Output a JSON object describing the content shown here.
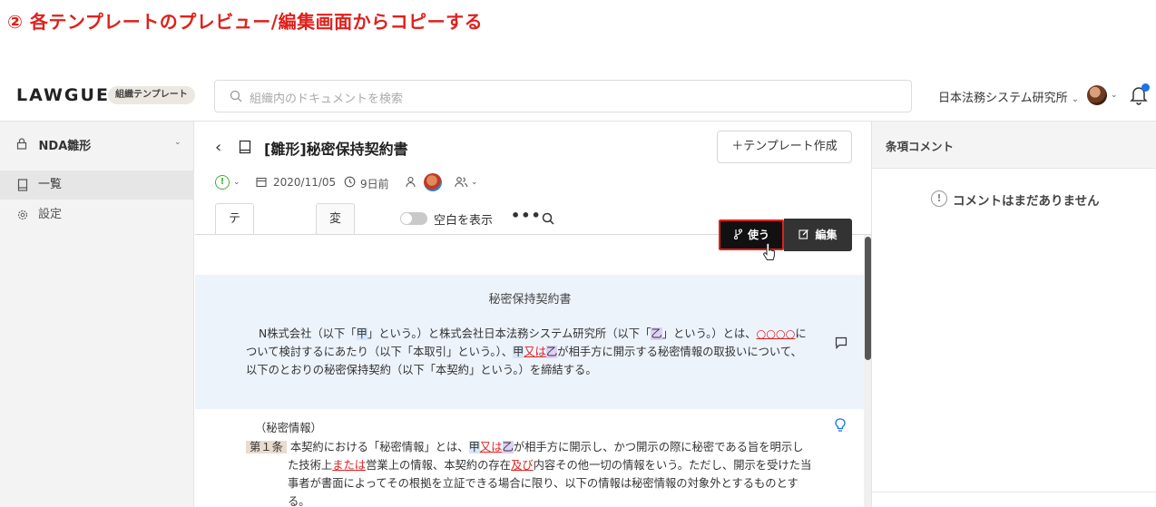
{
  "caption": "② 各テンプレートのプレビュー/編集画面からコピーする",
  "topbar": {
    "logo": "LAWGUE",
    "badge": "組織テンプレート",
    "search_placeholder": "組織内のドキュメントを検索",
    "org_name": "日本法務システム研究所",
    "org_chevron": "⌄"
  },
  "sidebar": {
    "project": "NDA雛形",
    "chevron": "⌄",
    "items": [
      {
        "label": "一覧",
        "icon": "document-icon"
      },
      {
        "label": "設定",
        "icon": "gear-icon"
      }
    ]
  },
  "document": {
    "back": "‹",
    "title": "[雛形]秘密保持契約書",
    "new_template_button": "＋テンプレート作成",
    "meta": {
      "status_icon": "!",
      "date": "2020/11/05",
      "relative": "9日前"
    },
    "tabs": {
      "template": "テンプレート",
      "history": "変更履歴",
      "show_blank": "空白を表示",
      "more": "•••"
    },
    "use_button": "使う",
    "edit_button": "編集",
    "heading": "秘密保持契約書",
    "preamble": {
      "t1": "N株式会社（以下「",
      "k1": "甲",
      "t2": "」という。）と株式会社日本法務システム研究所（以下「",
      "k2": "乙",
      "t3": "」という。）とは、",
      "red1": "○○○○",
      "t4": "について検討するにあたり（以下「本取引」という。）、",
      "k3": "甲",
      "red2": "又は",
      "k4": "乙",
      "t5": "が相手方に開示する秘密情報の取扱いについて、以下のとおりの秘密保持契約（以下「本契約」という。）を締結する。"
    },
    "article1": {
      "caption": "（秘密情報）",
      "label": "第１条",
      "t1": "本契約における「秘密情報」とは、",
      "k1": "甲",
      "red1": "又は",
      "k2": "乙",
      "t2": "が相手方に開示し、かつ開示の際に秘密である旨を明示した技術上",
      "red2": "または",
      "t3": "営業上の情報、本契約の存在",
      "red3": "及び",
      "t4": "内容その他一切の情報をいう。ただし、開示を受けた当事者が書面によってその根拠を立証できる場合に限り、以下の情報は秘密情報の対象外とするものとする。"
    }
  },
  "comments": {
    "title": "条項コメント",
    "empty_icon": "!",
    "empty": "コメントはまだありません"
  }
}
